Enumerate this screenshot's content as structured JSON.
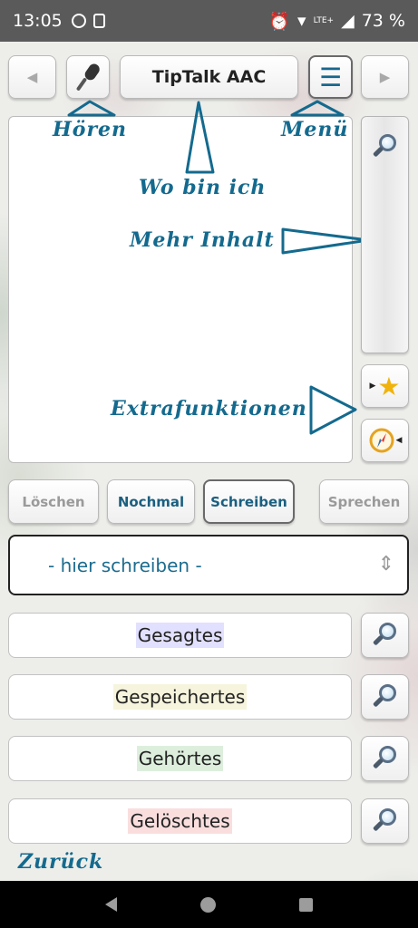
{
  "status_bar": {
    "time": "13:05",
    "network": "LTE+",
    "battery": "73 %"
  },
  "toolbar": {
    "back_arrow": "◀",
    "forward_arrow": "▶",
    "title": "TipTalk AAC",
    "menu_glyph": "☰"
  },
  "annotations": {
    "listen": "Hören",
    "menu": "Menü",
    "where_am_i": "Wo bin ich",
    "more_content": "Mehr Inhalt",
    "extra_functions": "Extrafunktionen",
    "back": "Zurück"
  },
  "actions": {
    "delete": "Löschen",
    "again": "Nochmal",
    "write": "Schreiben",
    "speak": "Sprechen"
  },
  "input": {
    "placeholder": "- hier schreiben -",
    "toggle_glyph": "⇕"
  },
  "lists": {
    "items": [
      {
        "label": "Gesagtes",
        "highlight": "#e2e0ff"
      },
      {
        "label": "Gespeichertes",
        "highlight": "#f6f4dc"
      },
      {
        "label": "Gehörtes",
        "highlight": "#ddeedd"
      },
      {
        "label": "Gelöschtes",
        "highlight": "#fadede"
      }
    ]
  },
  "colors": {
    "accent": "#146a8e",
    "status_bar": "#5a5a5a"
  }
}
